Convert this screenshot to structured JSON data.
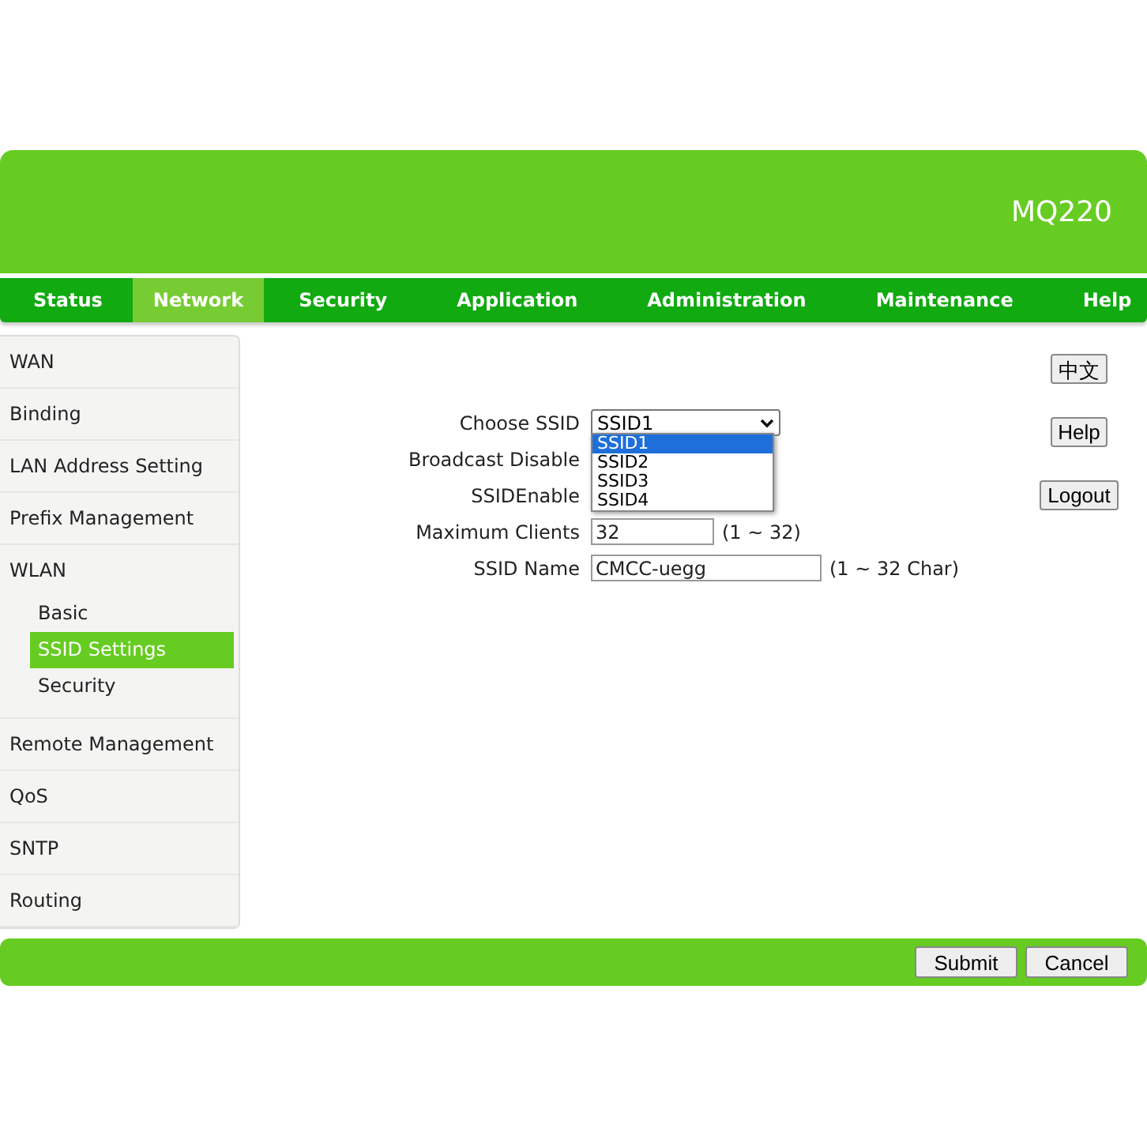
{
  "header": {
    "model": "MQ220"
  },
  "nav": [
    {
      "label": "Status",
      "selected": false
    },
    {
      "label": "Network",
      "selected": true
    },
    {
      "label": "Security",
      "selected": false
    },
    {
      "label": "Application",
      "selected": false
    },
    {
      "label": "Administration",
      "selected": false
    },
    {
      "label": "Maintenance",
      "selected": false
    },
    {
      "label": "Help",
      "selected": false
    }
  ],
  "sidebar": {
    "items": [
      {
        "label": "WAN",
        "selected": false
      },
      {
        "label": "Binding",
        "selected": false
      },
      {
        "label": "LAN Address Setting",
        "selected": false
      },
      {
        "label": "Prefix Management",
        "selected": false
      },
      {
        "label": "WLAN",
        "selected": false,
        "children": [
          {
            "label": "Basic",
            "selected": false
          },
          {
            "label": "SSID Settings",
            "selected": true
          },
          {
            "label": "Security",
            "selected": false
          }
        ]
      },
      {
        "label": "Remote Management",
        "selected": false
      },
      {
        "label": "QoS",
        "selected": false
      },
      {
        "label": "SNTP",
        "selected": false
      },
      {
        "label": "Routing",
        "selected": false
      }
    ]
  },
  "form": {
    "choose_ssid": {
      "label": "Choose SSID",
      "value": "SSID1",
      "expanded": true,
      "options": [
        {
          "label": "SSID1",
          "selected": true
        },
        {
          "label": "SSID2",
          "selected": false
        },
        {
          "label": "SSID3",
          "selected": false
        },
        {
          "label": "SSID4",
          "selected": false
        }
      ]
    },
    "broadcast_disable": {
      "label": "Broadcast Disable"
    },
    "ssid_enable": {
      "label": "SSIDEnable"
    },
    "maximum_clients": {
      "label": "Maximum Clients",
      "value": "32",
      "hint": "(1 ~ 32)"
    },
    "ssid_name": {
      "label": "SSID Name",
      "value": "CMCC-uegg",
      "hint": "(1 ~ 32 Char)"
    }
  },
  "side_buttons": [
    "中文",
    "Help",
    "Logout"
  ],
  "footer": {
    "buttons": [
      "Submit",
      "Cancel"
    ]
  }
}
